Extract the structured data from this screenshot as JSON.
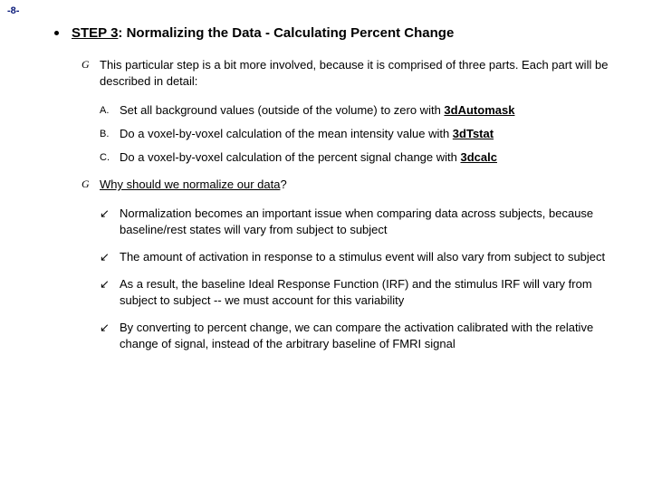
{
  "page_number": "-8-",
  "heading_step": "STEP 3",
  "heading_rest": ": Normalizing the Data - Calculating Percent Change",
  "intro": "This particular step is a bit more involved, because it is comprised of three parts.  Each part will be described in detail:",
  "abc": {
    "a_label": "A.",
    "a_text": "Set all background values (outside of the volume) to zero with ",
    "a_tool": "3dAutomask",
    "b_label": "B.",
    "b_text": "Do a voxel-by-voxel calculation of the mean intensity value with ",
    "b_tool": "3dTstat",
    "c_label": "C.",
    "c_text": "Do a voxel-by-voxel calculation of the percent signal change with ",
    "c_tool": "3dcalc"
  },
  "why_heading": "Why should we normalize our data",
  "why_q": "?",
  "arrows": [
    "Normalization becomes an important issue when comparing data across subjects, because baseline/rest states will vary from subject to subject",
    "The amount of activation in response to a stimulus event will also vary from subject to subject",
    "As a result, the baseline Ideal Response Function (IRF) and the stimulus IRF will vary from subject to subject -- we must account for this variability",
    "By converting to percent change, we can compare the activation calibrated with the relative change of signal, instead of the arbitrary baseline of FMRI signal"
  ],
  "glyphs": {
    "cap": "G",
    "arrow": "↙"
  }
}
